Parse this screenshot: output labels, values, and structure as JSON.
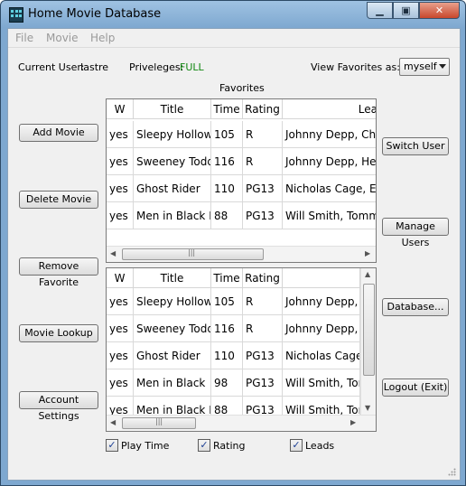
{
  "window": {
    "title": "Home Movie Database"
  },
  "menu": [
    {
      "label": "File"
    },
    {
      "label": "Movie"
    },
    {
      "label": "Help"
    }
  ],
  "status": {
    "current_user_label": "Current User:",
    "current_user": "Iastre",
    "privileges_label": "Priveleges:",
    "privileges": "FULL",
    "view_favorites_label": "View Favorites as:",
    "view_favorites_value": "myself",
    "favorites_heading": "Favorites"
  },
  "left_buttons": {
    "add_movie": "Add Movie",
    "delete_movie": "Delete Movie",
    "remove_favorite": "Remove Favorite",
    "movie_lookup": "Movie Lookup",
    "account_settings": "Account Settings"
  },
  "right_buttons": {
    "switch_user": "Switch User",
    "manage_users": "Manage Users",
    "database": "Database...",
    "logout": "Logout (Exit)"
  },
  "favorites_table": {
    "columns": [
      "W",
      "Title",
      "Time",
      "Rating",
      "Lea"
    ],
    "rows": [
      [
        "yes",
        "Sleepy Hollow",
        "105",
        "R",
        "Johnny Depp, Chris"
      ],
      [
        "yes",
        "Sweeney Todd",
        "116",
        "R",
        "Johnny Depp, Hele"
      ],
      [
        "yes",
        "Ghost Rider",
        "110",
        "PG13",
        "Nicholas Cage, Eva"
      ],
      [
        "yes",
        "Men in Black II",
        "88",
        "PG13",
        "Will Smith, Tommy"
      ]
    ]
  },
  "all_table": {
    "columns": [
      "W",
      "Title",
      "Time",
      "Rating"
    ],
    "rows": [
      [
        "yes",
        "Sleepy Hollow",
        "105",
        "R",
        "Johnny Depp, C"
      ],
      [
        "yes",
        "Sweeney Todd",
        "116",
        "R",
        "Johnny Depp, H"
      ],
      [
        "yes",
        "Ghost Rider",
        "110",
        "PG13",
        "Nicholas Cage,"
      ],
      [
        "yes",
        "Men in Black",
        "98",
        "PG13",
        "Will Smith, Tom"
      ],
      [
        "yes",
        "Men in Black II",
        "88",
        "PG13",
        "Will Smith, Tom"
      ]
    ]
  },
  "checkboxes": [
    {
      "label": "Play Time",
      "checked": true
    },
    {
      "label": "Rating",
      "checked": true
    },
    {
      "label": "Leads",
      "checked": true
    }
  ]
}
